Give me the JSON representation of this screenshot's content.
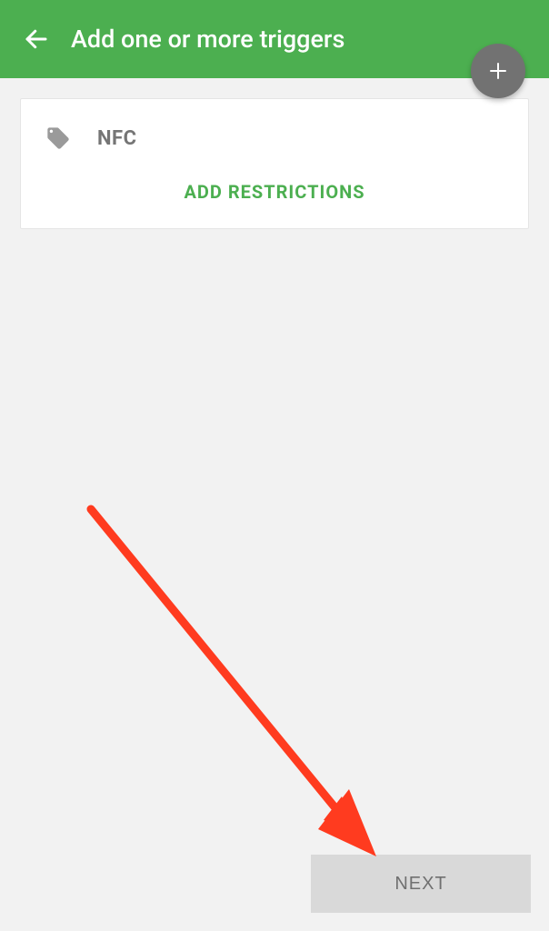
{
  "appbar": {
    "title": "Add one or more triggers"
  },
  "fab": {
    "icon": "plus-icon"
  },
  "card": {
    "trigger": {
      "icon": "tag-icon",
      "label": "NFC"
    },
    "restrictions_label": "ADD RESTRICTIONS"
  },
  "footer": {
    "next_label": "NEXT"
  },
  "annotation": {
    "type": "arrow",
    "color": "#ff3b1f",
    "target": "next-button"
  }
}
